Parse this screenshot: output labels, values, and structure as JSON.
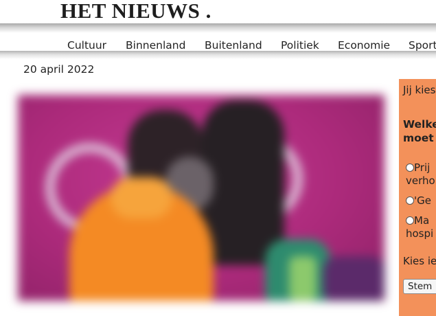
{
  "site": {
    "logo": "HET NIEUWS ."
  },
  "nav": [
    {
      "label": "Cultuur"
    },
    {
      "label": "Binnenland"
    },
    {
      "label": "Buitenland"
    },
    {
      "label": "Politiek"
    },
    {
      "label": "Economie"
    },
    {
      "label": "Sport"
    }
  ],
  "article": {
    "date": "20 april 2022"
  },
  "poll": {
    "intro": "Jij kies",
    "question_line1": "Welke",
    "question_line2": "moet",
    "options": [
      {
        "line1": "Prij",
        "line2": "verho"
      },
      {
        "line1": "'Ge",
        "line2": ""
      },
      {
        "line1": "Ma",
        "line2": "hospi"
      }
    ],
    "choose": "Kies ie",
    "vote_button": "Stem"
  },
  "colors": {
    "sidebar_bg": "#f3915a",
    "hero_bg": "#b8307f"
  }
}
